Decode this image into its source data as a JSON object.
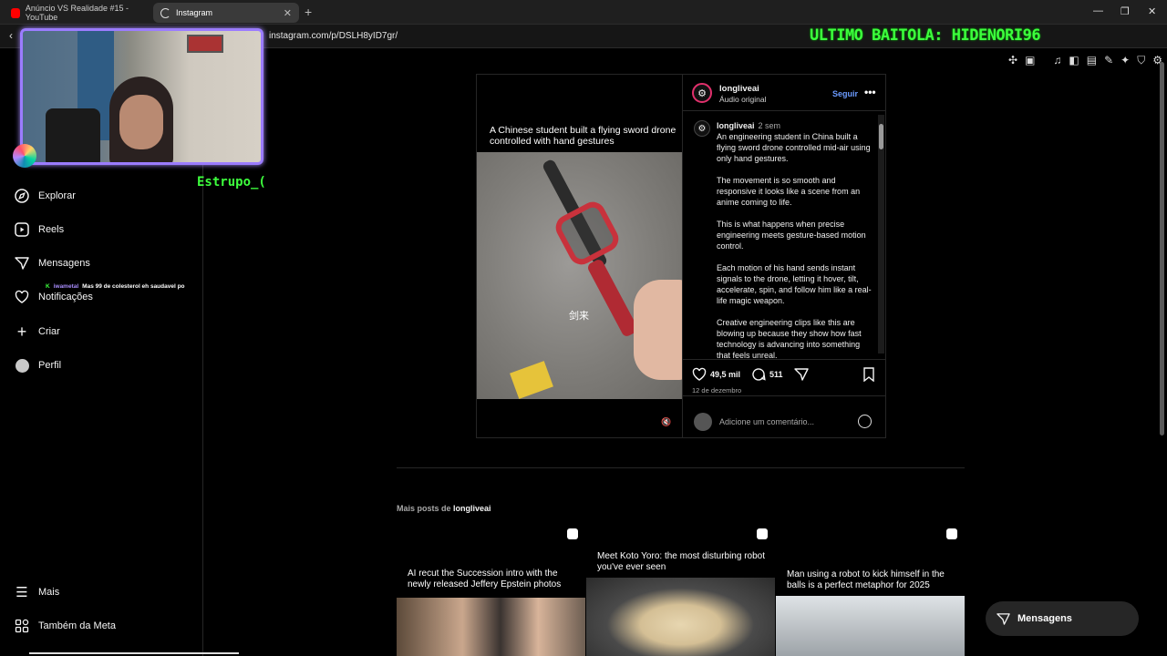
{
  "browser": {
    "tabs": [
      {
        "label": "Anúncio VS Realidade #15 - YouTube",
        "color": "#ff0000"
      },
      {
        "label": "Instagram",
        "color": "#ffffff"
      }
    ],
    "url": "instagram.com/p/DSLH8yID7gr/"
  },
  "stream": {
    "overlay_text": "ULTIMO BAITOLA: HIDENORI96",
    "streamer_name": "Estrupo_(",
    "chat": {
      "badge": "K",
      "user": "iwametal",
      "message": "Mas 99 de colesterol eh saudavel po"
    }
  },
  "sidebar": {
    "items": [
      {
        "label": "Explorar",
        "icon": "compass-icon"
      },
      {
        "label": "Reels",
        "icon": "reels-icon"
      },
      {
        "label": "Mensagens",
        "icon": "messages-icon"
      },
      {
        "label": "Notificações",
        "icon": "heart-icon"
      },
      {
        "label": "Criar",
        "icon": "plus-icon"
      },
      {
        "label": "Perfil",
        "icon": "profile-icon"
      }
    ],
    "bottom": [
      {
        "label": "Mais",
        "icon": "menu-icon"
      },
      {
        "label": "Também da Meta",
        "icon": "meta-icon"
      }
    ]
  },
  "post": {
    "video_caption": "A Chinese student built a flying sword drone controlled with hand gestures",
    "video_overlay": "剑来",
    "username": "longliveai",
    "audio": "Áudio original",
    "follow_label": "Seguir",
    "comment": {
      "username": "longliveai",
      "time": "2 sem",
      "paragraphs": [
        "An engineering student in China built a flying sword drone controlled mid-air using only hand gestures.",
        "The movement is so smooth and responsive it looks like a scene from an anime coming to life.",
        "This is what happens when precise engineering meets gesture-based motion control.",
        "Each motion of his hand sends instant signals to the drone, letting it hover, tilt, accelerate, spin, and follow him like a real-life magic weapon.",
        "Creative engineering clips like this are blowing up because they show how fast technology is advancing into something that feels unreal."
      ]
    },
    "likes": "49,5 mil",
    "comments_count": "511",
    "date": "12 de dezembro",
    "add_comment_placeholder": "Adicione um comentário..."
  },
  "more_posts": {
    "prefix": "Mais posts de",
    "username": "longliveai",
    "items": [
      {
        "title": "AI recut the Succession intro with the newly released Jeffery Epstein photos"
      },
      {
        "title": "Meet Koto Yoro: the most disturbing robot you've ever seen"
      },
      {
        "title": "Man using a robot to kick himself in the balls is a perfect metaphor for 2025"
      }
    ]
  },
  "floating_messages": "Mensagens"
}
